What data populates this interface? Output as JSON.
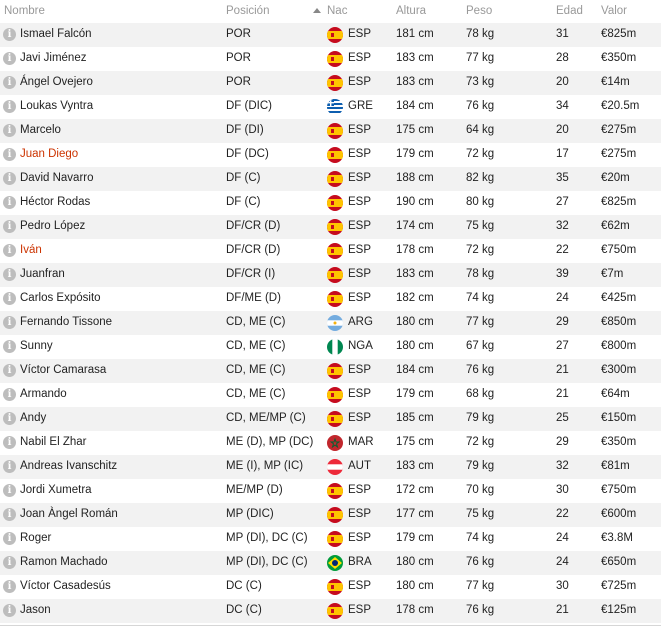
{
  "header": {
    "name": "Nombre",
    "position": "Posición",
    "nation": "Nac",
    "height": "Altura",
    "weight": "Peso",
    "age": "Edad",
    "value": "Valor"
  },
  "info_glyph": "i",
  "flag_colors": {
    "ESP": [
      "#c60b1e",
      "#ffc400"
    ],
    "GRE": [
      "#0d5eaf",
      "#ffffff"
    ],
    "ARG": [
      "#74acdf",
      "#ffffff"
    ],
    "NGA": [
      "#008751",
      "#ffffff"
    ],
    "MAR": [
      "#c1272d",
      "#006233"
    ],
    "AUT": [
      "#ed2939",
      "#ffffff"
    ],
    "BRA": [
      "#009c3b",
      "#ffdf00"
    ]
  },
  "players": [
    {
      "name": "Ismael Falcón",
      "position": "POR",
      "nation": "ESP",
      "height": "181 cm",
      "weight": "78 kg",
      "age": "31",
      "value": "€825m",
      "highlight": false
    },
    {
      "name": "Javi Jiménez",
      "position": "POR",
      "nation": "ESP",
      "height": "183 cm",
      "weight": "77 kg",
      "age": "28",
      "value": "€350m",
      "highlight": false
    },
    {
      "name": "Ángel Ovejero",
      "position": "POR",
      "nation": "ESP",
      "height": "183 cm",
      "weight": "73 kg",
      "age": "20",
      "value": "€14m",
      "highlight": false
    },
    {
      "name": "Loukas Vyntra",
      "position": "DF (DIC)",
      "nation": "GRE",
      "height": "184 cm",
      "weight": "76 kg",
      "age": "34",
      "value": "€20.5m",
      "highlight": false
    },
    {
      "name": "Marcelo",
      "position": "DF (DI)",
      "nation": "ESP",
      "height": "175 cm",
      "weight": "64 kg",
      "age": "20",
      "value": "€275m",
      "highlight": false
    },
    {
      "name": "Juan Diego",
      "position": "DF (DC)",
      "nation": "ESP",
      "height": "179 cm",
      "weight": "72 kg",
      "age": "17",
      "value": "€275m",
      "highlight": true
    },
    {
      "name": "David Navarro",
      "position": "DF (C)",
      "nation": "ESP",
      "height": "188 cm",
      "weight": "82 kg",
      "age": "35",
      "value": "€20m",
      "highlight": false
    },
    {
      "name": "Héctor Rodas",
      "position": "DF (C)",
      "nation": "ESP",
      "height": "190 cm",
      "weight": "80 kg",
      "age": "27",
      "value": "€825m",
      "highlight": false
    },
    {
      "name": "Pedro López",
      "position": "DF/CR (D)",
      "nation": "ESP",
      "height": "174 cm",
      "weight": "75 kg",
      "age": "32",
      "value": "€62m",
      "highlight": false
    },
    {
      "name": "Iván",
      "position": "DF/CR (D)",
      "nation": "ESP",
      "height": "178 cm",
      "weight": "72 kg",
      "age": "22",
      "value": "€750m",
      "highlight": true
    },
    {
      "name": "Juanfran",
      "position": "DF/CR (I)",
      "nation": "ESP",
      "height": "183 cm",
      "weight": "78 kg",
      "age": "39",
      "value": "€7m",
      "highlight": false
    },
    {
      "name": "Carlos Expósito",
      "position": "DF/ME (D)",
      "nation": "ESP",
      "height": "182 cm",
      "weight": "74 kg",
      "age": "24",
      "value": "€425m",
      "highlight": false
    },
    {
      "name": "Fernando Tissone",
      "position": "CD, ME (C)",
      "nation": "ARG",
      "height": "180 cm",
      "weight": "77 kg",
      "age": "29",
      "value": "€850m",
      "highlight": false
    },
    {
      "name": "Sunny",
      "position": "CD, ME (C)",
      "nation": "NGA",
      "height": "180 cm",
      "weight": "67 kg",
      "age": "27",
      "value": "€800m",
      "highlight": false
    },
    {
      "name": "Víctor Camarasa",
      "position": "CD, ME (C)",
      "nation": "ESP",
      "height": "184 cm",
      "weight": "76 kg",
      "age": "21",
      "value": "€300m",
      "highlight": false
    },
    {
      "name": "Armando",
      "position": "CD, ME (C)",
      "nation": "ESP",
      "height": "179 cm",
      "weight": "68 kg",
      "age": "21",
      "value": "€64m",
      "highlight": false
    },
    {
      "name": "Andy",
      "position": "CD, ME/MP (C)",
      "nation": "ESP",
      "height": "185 cm",
      "weight": "79 kg",
      "age": "25",
      "value": "€150m",
      "highlight": false
    },
    {
      "name": "Nabil El Zhar",
      "position": "ME (D), MP (DC)",
      "nation": "MAR",
      "height": "175 cm",
      "weight": "72 kg",
      "age": "29",
      "value": "€350m",
      "highlight": false
    },
    {
      "name": "Andreas Ivanschitz",
      "position": "ME (I), MP (IC)",
      "nation": "AUT",
      "height": "183 cm",
      "weight": "79 kg",
      "age": "32",
      "value": "€81m",
      "highlight": false
    },
    {
      "name": "Jordi Xumetra",
      "position": "ME/MP (D)",
      "nation": "ESP",
      "height": "172 cm",
      "weight": "70 kg",
      "age": "30",
      "value": "€750m",
      "highlight": false
    },
    {
      "name": "Joan Àngel Román",
      "position": "MP (DIC)",
      "nation": "ESP",
      "height": "177 cm",
      "weight": "75 kg",
      "age": "22",
      "value": "€600m",
      "highlight": false
    },
    {
      "name": "Roger",
      "position": "MP (DI), DC (C)",
      "nation": "ESP",
      "height": "179 cm",
      "weight": "74 kg",
      "age": "24",
      "value": "€3.8M",
      "highlight": false
    },
    {
      "name": "Ramon Machado",
      "position": "MP (DI), DC (C)",
      "nation": "BRA",
      "height": "180 cm",
      "weight": "76 kg",
      "age": "24",
      "value": "€650m",
      "highlight": false
    },
    {
      "name": "Víctor Casadesús",
      "position": "DC (C)",
      "nation": "ESP",
      "height": "180 cm",
      "weight": "77 kg",
      "age": "30",
      "value": "€725m",
      "highlight": false
    },
    {
      "name": "Jason",
      "position": "DC (C)",
      "nation": "ESP",
      "height": "178 cm",
      "weight": "76 kg",
      "age": "21",
      "value": "€125m",
      "highlight": false
    }
  ]
}
